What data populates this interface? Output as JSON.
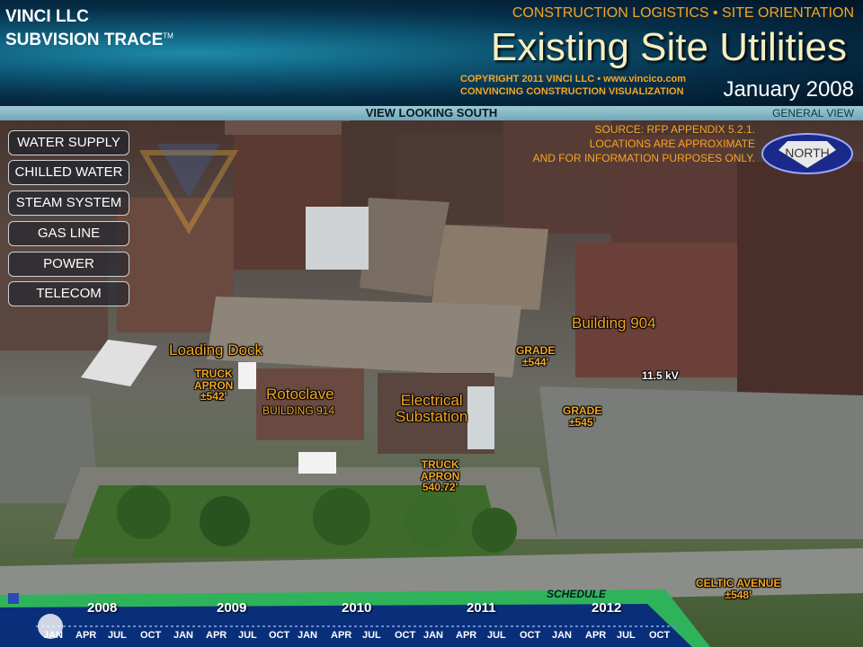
{
  "brand": {
    "line1": "VINCI LLC",
    "line2": "SUBVISION TRACE",
    "tm": "TM"
  },
  "header": {
    "subtitle": "CONSTRUCTION LOGISTICS • SITE ORIENTATION",
    "title": "Existing Site Utilities",
    "copyright_line1": "COPYRIGHT 2011 VINCI LLC • www.vincico.com",
    "copyright_line2": "CONVINCING CONSTRUCTION VISUALIZATION",
    "date": "January 2008"
  },
  "viewbar": {
    "view": "VIEW LOOKING SOUTH",
    "general": "GENERAL VIEW"
  },
  "menu": [
    {
      "label": "WATER SUPPLY"
    },
    {
      "label": "CHILLED WATER"
    },
    {
      "label": "STEAM SYSTEM"
    },
    {
      "label": "GAS LINE"
    },
    {
      "label": "POWER"
    },
    {
      "label": "TELECOM"
    }
  ],
  "source_note": {
    "line1": "SOURCE: RFP APPENDIX 5.2.1.",
    "line2": "LOCATIONS ARE APPROXIMATE",
    "line3": "AND FOR INFORMATION PURPOSES ONLY."
  },
  "compass": {
    "label": "NORTH"
  },
  "map_labels": {
    "loading_dock": "Loading Dock",
    "truck_apron_1": "TRUCK",
    "truck_apron_1b": "APRON",
    "truck_apron_1c": "±542'",
    "rotoclave": "Rotoclave",
    "building_914": "BUILDING 914",
    "electrical_1": "Electrical",
    "electrical_2": "Substation",
    "grade_1a": "GRADE",
    "grade_1b": "±544'",
    "building_904": "Building 904",
    "kv": "11.5 kV",
    "grade_2a": "GRADE",
    "grade_2b": "±545'",
    "truck_apron_2a": "TRUCK",
    "truck_apron_2b": "APRON",
    "truck_apron_2c": "540.72'",
    "celtic_1": "CELTIC AVENUE",
    "celtic_2": "±548'"
  },
  "timeline": {
    "schedule": "SCHEDULE",
    "years": [
      "2008",
      "2009",
      "2010",
      "2011",
      "2012"
    ],
    "months": [
      "JAN",
      "APR",
      "JUL",
      "OCT",
      "JAN",
      "APR",
      "JUL",
      "OCT",
      "JAN",
      "APR",
      "JUL",
      "OCT",
      "JAN",
      "APR",
      "JUL",
      "OCT",
      "JAN",
      "APR",
      "JUL",
      "OCT"
    ]
  },
  "colors": {
    "accent": "#f5a623",
    "header_dark": "#021526",
    "timeline_green": "#2fb35a",
    "timeline_blue": "#0a2f7a"
  }
}
